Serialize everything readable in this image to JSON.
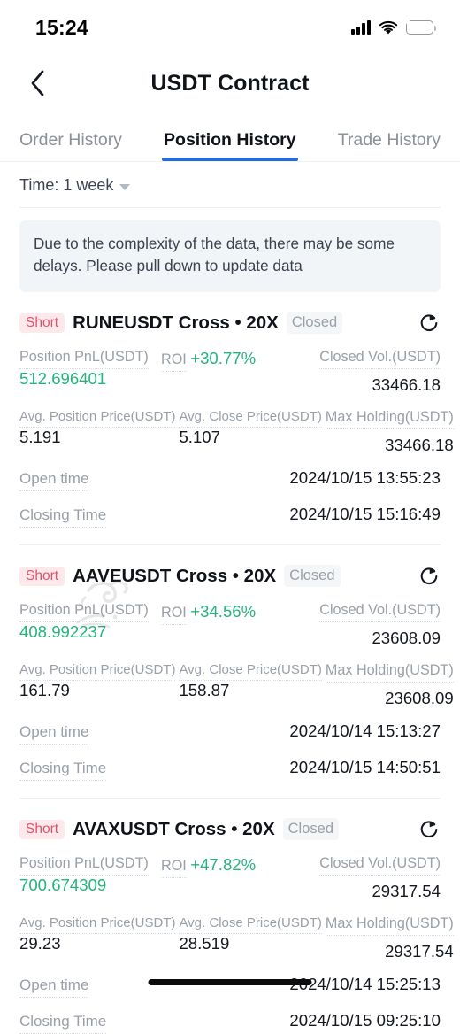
{
  "status_bar": {
    "time": "15:24",
    "icons": {
      "signal": "signal-bars-icon",
      "wifi": "wifi-icon",
      "battery": "battery-charging-icon"
    }
  },
  "header": {
    "back_icon": "chevron-left-icon",
    "title": "USDT Contract"
  },
  "tabs": [
    {
      "label": "Order History",
      "active": false
    },
    {
      "label": "Position History",
      "active": true
    },
    {
      "label": "Trade History",
      "active": false
    }
  ],
  "filter": {
    "label": "Time: 1 week",
    "caret_icon": "chevron-down-icon"
  },
  "notice": {
    "text": "Due to the complexity of the data, there may be some delays. Please pull down to update data"
  },
  "labels": {
    "position_pnl": "Position PnL(USDT)",
    "roi": "ROI",
    "closed_vol": "Closed Vol.(USDT)",
    "avg_position_price": "Avg. Position Price(USDT)",
    "avg_close_price": "Avg. Close Price(USDT)",
    "max_holding": "Max Holding(USDT)",
    "open_time": "Open time",
    "closing_time": "Closing Time",
    "refresh_icon": "refresh-circle-icon"
  },
  "colors": {
    "accent_blue": "#2a6ad1",
    "profit_green": "#25b47e",
    "short_red": "#e2536a",
    "short_bg": "#fde9ec",
    "notice_bg": "#f2f5f7"
  },
  "positions": [
    {
      "side": "Short",
      "pair": "RUNEUSDT Cross • 20X",
      "status": "Closed",
      "pnl": "512.696401",
      "roi": "+30.77%",
      "closed_vol": "33466.18",
      "avg_position_price": "5.191",
      "avg_close_price": "5.107",
      "max_holding": "33466.18",
      "open_time": "2024/10/15 13:55:23",
      "closing_time": "2024/10/15 15:16:49"
    },
    {
      "side": "Short",
      "pair": "AAVEUSDT Cross • 20X",
      "status": "Closed",
      "pnl": "408.992237",
      "roi": "+34.56%",
      "closed_vol": "23608.09",
      "avg_position_price": "161.79",
      "avg_close_price": "158.87",
      "max_holding": "23608.09",
      "open_time": "2024/10/14 15:13:27",
      "closing_time": "2024/10/15 14:50:51"
    },
    {
      "side": "Short",
      "pair": "AVAXUSDT Cross • 20X",
      "status": "Closed",
      "pnl": "700.674309",
      "roi": "+47.82%",
      "closed_vol": "29317.54",
      "avg_position_price": "29.23",
      "avg_close_price": "28.519",
      "max_holding": "29317.54",
      "open_time": "2024/10/14 15:25:13",
      "closing_time": "2024/10/15 09:25:10"
    }
  ]
}
